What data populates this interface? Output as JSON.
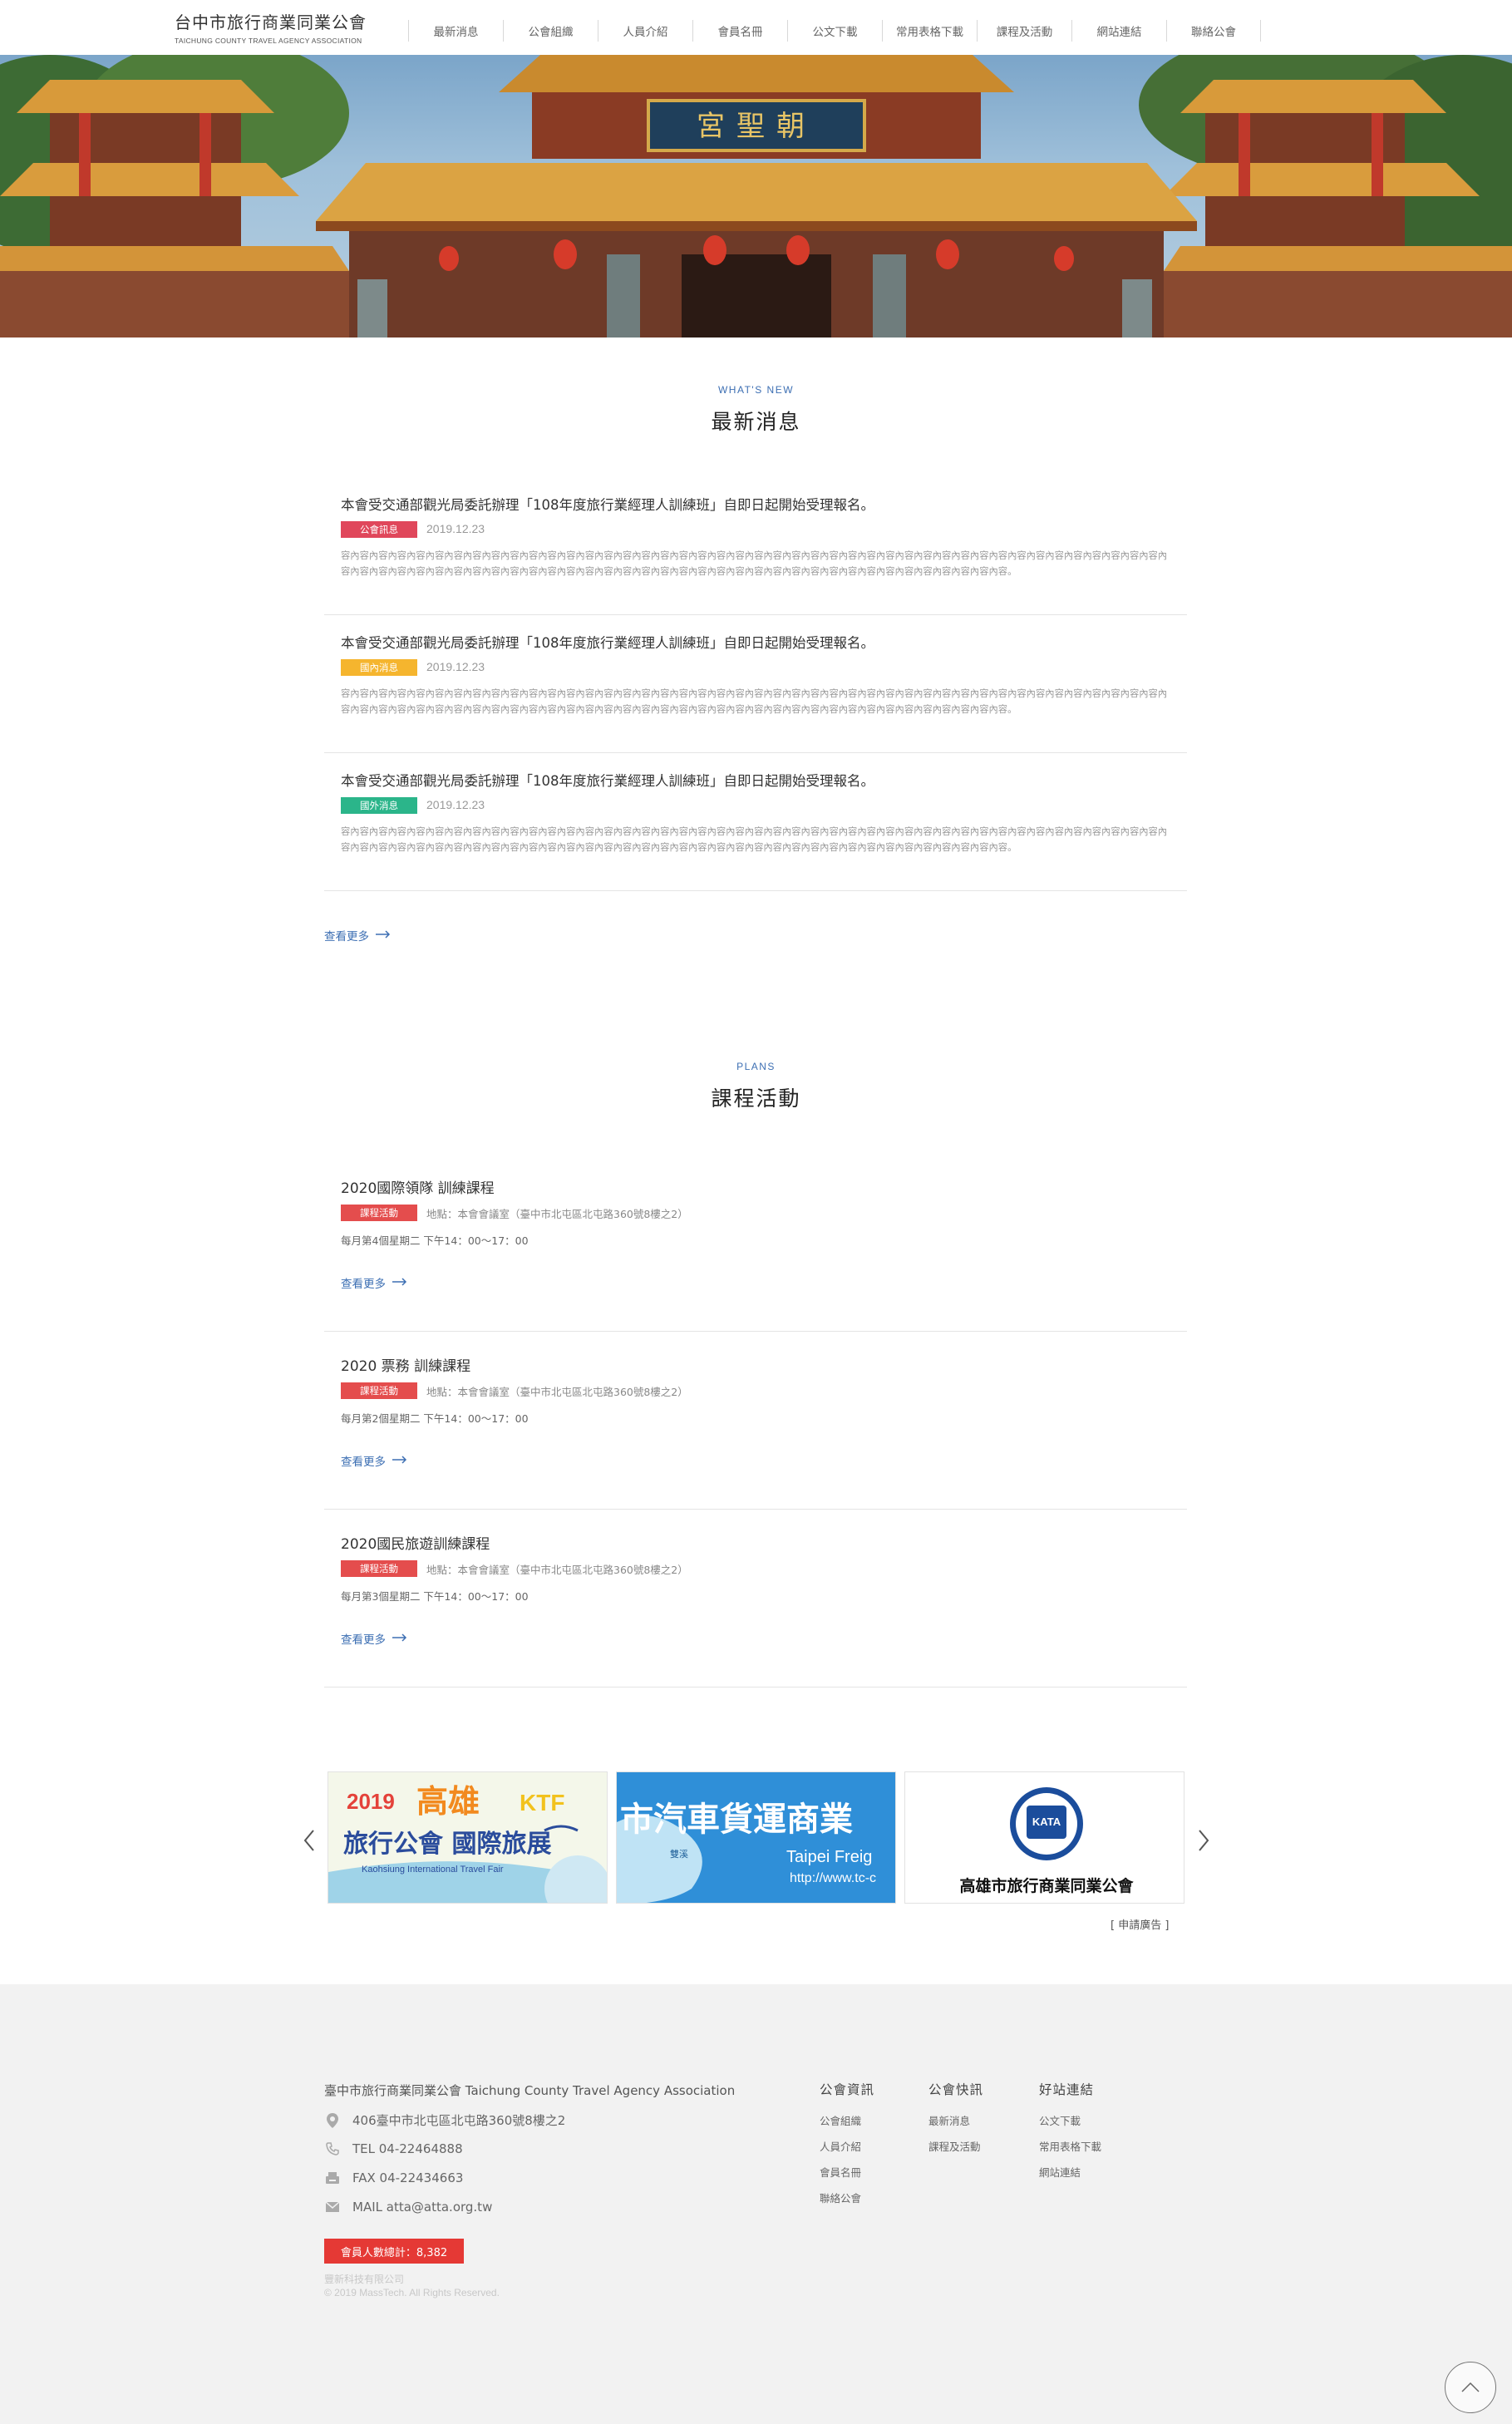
{
  "header": {
    "logo_zh": "台中市旅行商業同業公會",
    "logo_en": "TAICHUNG COUNTY TRAVEL AGENCY ASSOCIATION",
    "nav": [
      "最新消息",
      "公會組織",
      "人員介紹",
      "會員名冊",
      "公文下載",
      "常用表格下載",
      "課程及活動",
      "網站連結",
      "聯絡公會"
    ]
  },
  "hero": {
    "plaque": "宮聖朝"
  },
  "news_section": {
    "en": "WHAT'S NEW",
    "zh": "最新消息",
    "more": "查看更多",
    "items": [
      {
        "title": "本會受交通部觀光局委託辦理「108年度旅行業經理人訓練班」自即日起開始受理報名。",
        "badge": "公會訊息",
        "badge_color": "#e0475b",
        "date": "2019.12.23",
        "body": "容內容內容內容內容內容內容內容內容內容內容內容內容內容內容內容內容內容內容內容內容內容內容內容內容內容內容內容內容內容內容內容內容內容內容內容內容內容內容內容內容內容內容內容內容內容內容內容內容內容內容內容內容內容內容內容內容內容內容內容內容內容內容內容內容內容內容內容內容內容內容內容內容內容內容內容內容內容內容內容。"
      },
      {
        "title": "本會受交通部觀光局委託辦理「108年度旅行業經理人訓練班」自即日起開始受理報名。",
        "badge": "國內消息",
        "badge_color": "#f5b52e",
        "date": "2019.12.23",
        "body": "容內容內容內容內容內容內容內容內容內容內容內容內容內容內容內容內容內容內容內容內容內容內容內容內容內容內容內容內容內容內容內容內容內容內容內容內容內容內容內容內容內容內容內容內容內容內容內容內容內容內容內容內容內容內容內容內容內容內容內容內容內容內容內容內容內容內容內容內容內容內容內容內容內容內容內容內容內容內容內容。"
      },
      {
        "title": "本會受交通部觀光局委託辦理「108年度旅行業經理人訓練班」自即日起開始受理報名。",
        "badge": "國外消息",
        "badge_color": "#2bb58a",
        "date": "2019.12.23",
        "body": "容內容內容內容內容內容內容內容內容內容內容內容內容內容內容內容內容內容內容內容內容內容內容內容內容內容內容內容內容內容內容內容內容內容內容內容內容內容內容內容內容內容內容內容內容內容內容內容內容內容內容內容內容內容內容內容內容內容內容內容內容內容內容內容內容內容內容內容內容內容內容內容內容內容內容內容內容內容內容內容。"
      }
    ]
  },
  "plans_section": {
    "en": "PLANS",
    "zh": "課程活動",
    "items": [
      {
        "title": "2020國際領隊 訓練課程",
        "badge": "課程活動",
        "location": "地點：本會會議室（臺中市北屯區北屯路360號8樓之2）",
        "time": "每月第4個星期二 下午14：00～17：00",
        "more": "查看更多"
      },
      {
        "title": "2020 票務 訓練課程",
        "badge": "課程活動",
        "location": "地點：本會會議室（臺中市北屯區北屯路360號8樓之2）",
        "time": "每月第2個星期二 下午14：00～17：00",
        "more": "查看更多"
      },
      {
        "title": "2020國民旅遊訓練課程",
        "badge": "課程活動",
        "location": "地點：本會會議室（臺中市北屯區北屯路360號8樓之2）",
        "time": "每月第3個星期二 下午14：00～17：00",
        "more": "查看更多"
      }
    ]
  },
  "ads": {
    "apply": "[ 申請廣告 ]",
    "ad1": {
      "year": "2019",
      "city": "高雄",
      "brand": "KTF",
      "line2": "旅行公會 國際旅展",
      "line3": "Kaohsiung International Travel Fair"
    },
    "ad2": {
      "text": "市汽車貨運商業",
      "sub": "Taipei Freig",
      "url": "http://www.tc-c",
      "place": "雙溪"
    },
    "ad3": {
      "logo": "KATA",
      "name": "高雄市旅行商業同業公會"
    }
  },
  "footer": {
    "org": "臺中市旅行商業同業公會 Taichung County Travel Agency Association",
    "address": "406臺中市北屯區北屯路360號8樓之2",
    "tel": "TEL 04-22464888",
    "fax": "FAX 04-22434663",
    "mail": "MAIL atta@atta.org.tw",
    "counter": "會員人數總計：8,382",
    "company": "豐新科技有限公司",
    "copyright": "© 2019 MassTech. All Rights Reserved.",
    "columns": [
      {
        "title": "公會資訊",
        "links": [
          "公會組織",
          "人員介紹",
          "會員名冊",
          "聯絡公會"
        ]
      },
      {
        "title": "公會快訊",
        "links": [
          "最新消息",
          "課程及活動"
        ]
      },
      {
        "title": "好站連結",
        "links": [
          "公文下載",
          "常用表格下載",
          "網站連結"
        ]
      }
    ]
  }
}
